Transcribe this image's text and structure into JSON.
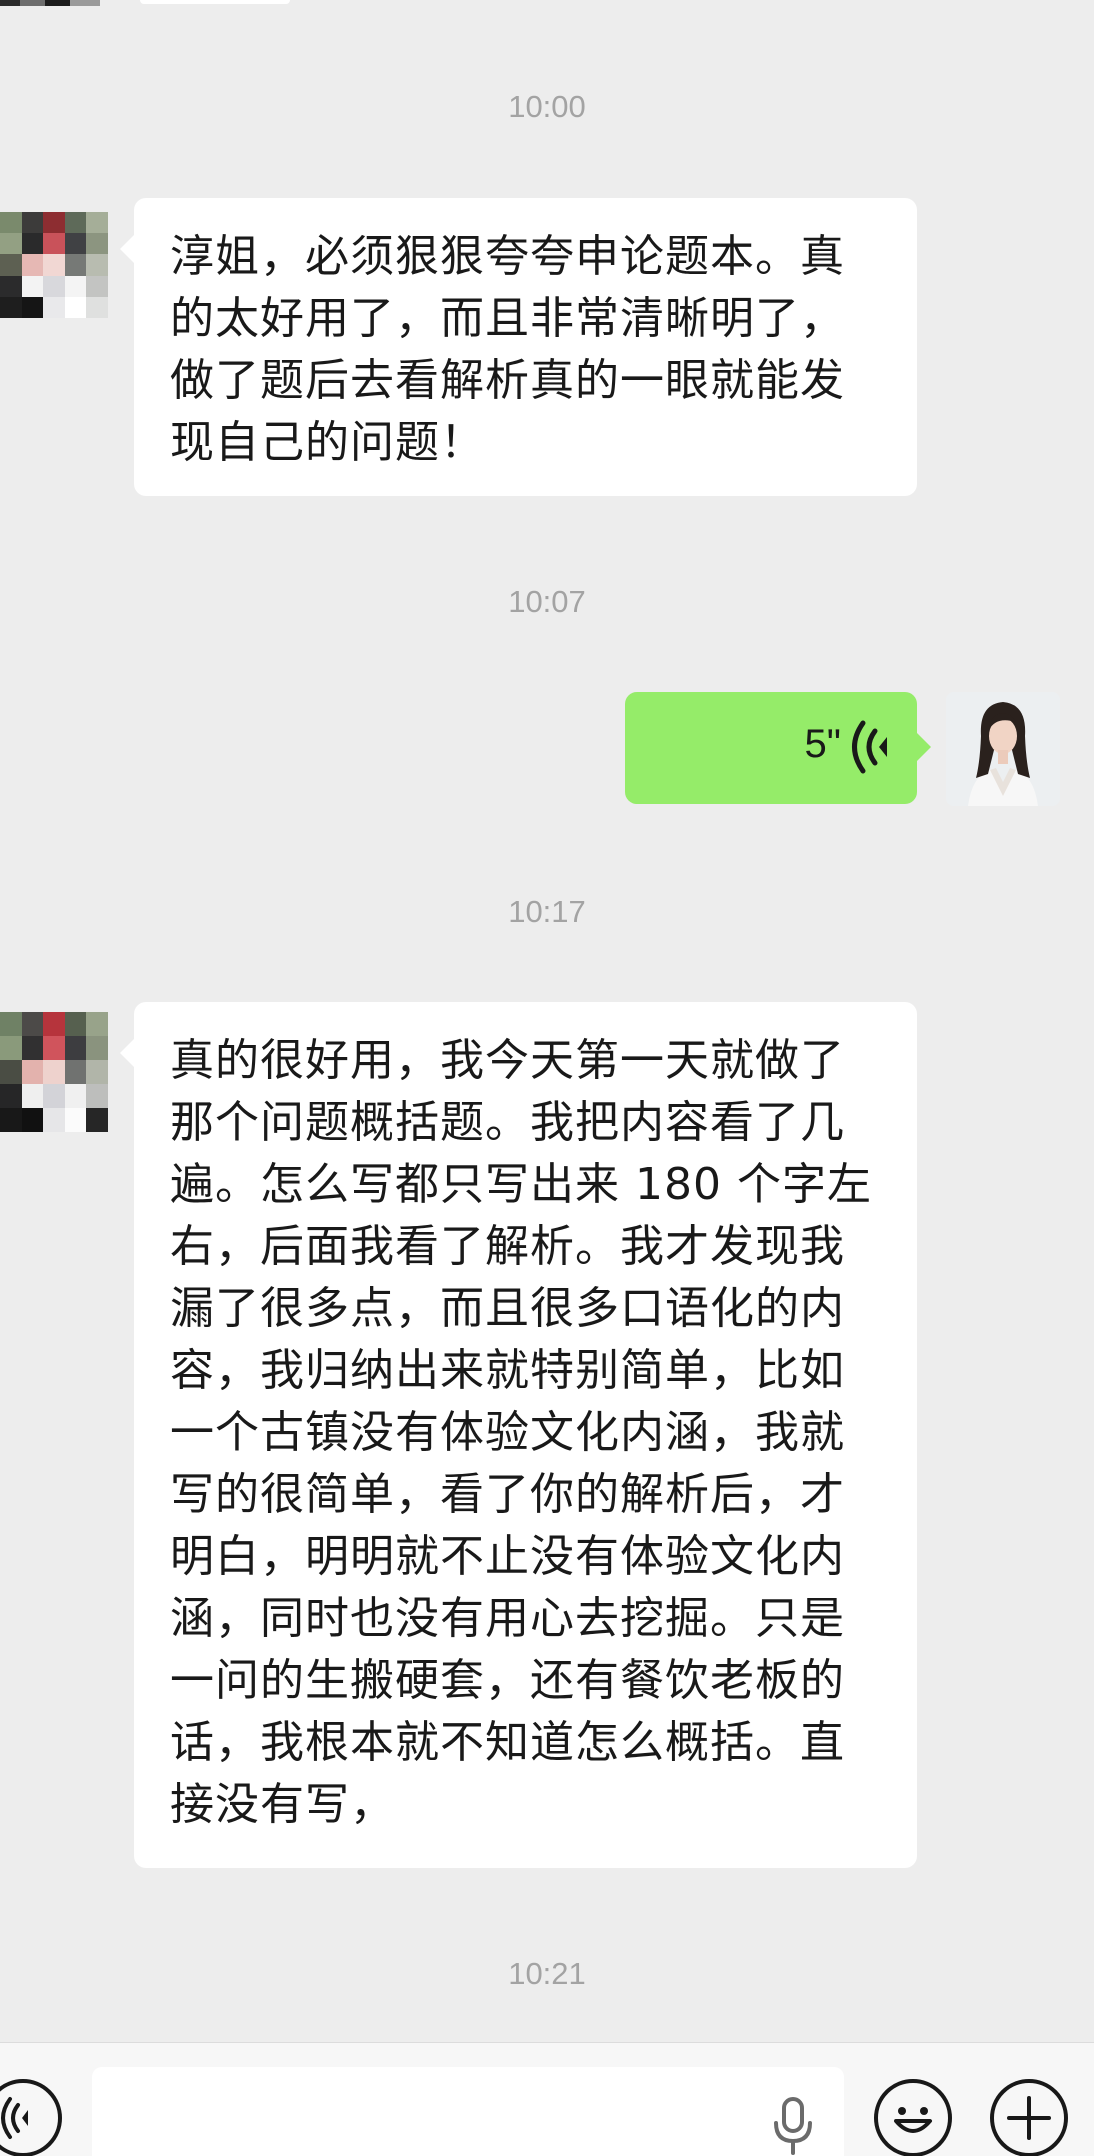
{
  "chat": {
    "timestamps": {
      "t1": "10:00",
      "t2": "10:07",
      "t3": "10:17",
      "t4": "10:21"
    },
    "messages": [
      {
        "sender": "contact",
        "lines": [
          "淳姐，必须狠狠夸夸申论题本。真",
          "的太好用了，而且非常清晰明了，",
          "做了题后去看解析真的一眼就能发",
          "现自己的问题！"
        ]
      },
      {
        "sender": "self",
        "type": "voice",
        "duration": "5\""
      },
      {
        "sender": "contact",
        "lines": [
          "真的很好用，我今天第一天就做了",
          "那个问题概括题。我把内容看了几",
          "遍。怎么写都只写出来 180 个字左",
          "右，后面我看了解析。我才发现我",
          "漏了很多点，而且很多口语化的内",
          "容，我归纳出来就特别简单，比如",
          "一个古镇没有体验文化内涵，我就",
          "写的很简单，看了你的解析后，才",
          "明白，明明就不止没有体验文化内",
          "涵，同时也没有用心去挖掘。只是",
          "一问的生搬硬套，还有餐饮老板的",
          "话，我根本就不知道怎么概括。直",
          "接没有写，"
        ]
      }
    ]
  },
  "colors": {
    "background": "#ededed",
    "incoming_bubble": "#ffffff",
    "outgoing_bubble": "#95ec69",
    "timestamp_text": "#a3a3a3",
    "message_text": "#191919"
  },
  "icons": {
    "voice_toggle": "voice-toggle-icon",
    "microphone": "microphone-icon",
    "emoji": "emoji-icon",
    "plus": "plus-icon",
    "voice_wave": "voice-wave-icon"
  }
}
